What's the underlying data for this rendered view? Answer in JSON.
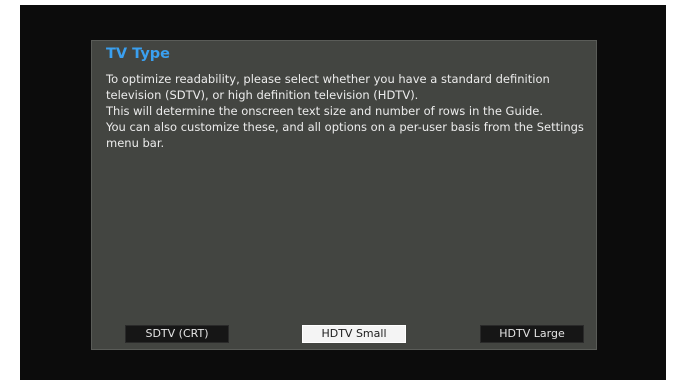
{
  "dialog": {
    "title": "TV Type",
    "body_lines": [
      "To optimize readability, please select whether you have a standard definition television (SDTV), or high definition television (HDTV).",
      "This will determine the onscreen text size and number of rows in the Guide.",
      "You can also customize these, and all options on a per-user basis from the Settings menu bar."
    ]
  },
  "options": {
    "sdtv_label": "SDTV (CRT)",
    "hdtv_small_label": "HDTV Small",
    "hdtv_large_label": "HDTV Large",
    "selected": "HDTV Small"
  },
  "colors": {
    "title": "#3aa0f0",
    "dialog_background": "#434541",
    "screen_background": "#0c0c0c",
    "button_background": "#161616",
    "selected_button_background": "#f4f4f4"
  }
}
